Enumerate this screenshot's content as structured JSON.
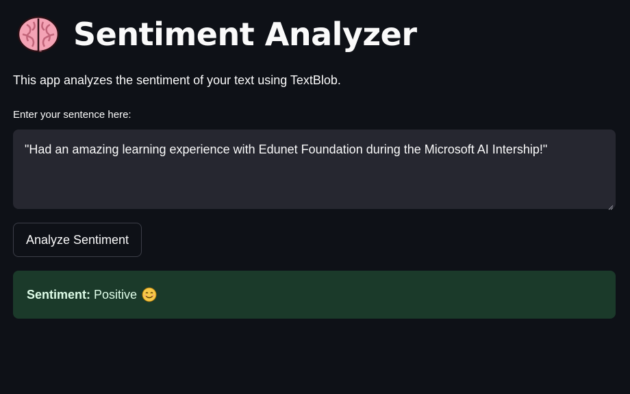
{
  "header": {
    "title": "Sentiment Analyzer",
    "icon": "brain-icon"
  },
  "intro": {
    "text": "This app analyzes the sentiment of your text using TextBlob."
  },
  "input": {
    "label": "Enter your sentence here:",
    "value": "\"Had an amazing learning experience with Edunet Foundation during the Microsoft AI Intership!\""
  },
  "actions": {
    "analyze_label": "Analyze Sentiment"
  },
  "result": {
    "label": "Sentiment:",
    "value": "Positive",
    "icon": "smiling-face-icon"
  },
  "colors": {
    "background": "#0e1117",
    "input_background": "#262730",
    "success_background": "#1b3a2a",
    "success_text": "#dffde9"
  }
}
